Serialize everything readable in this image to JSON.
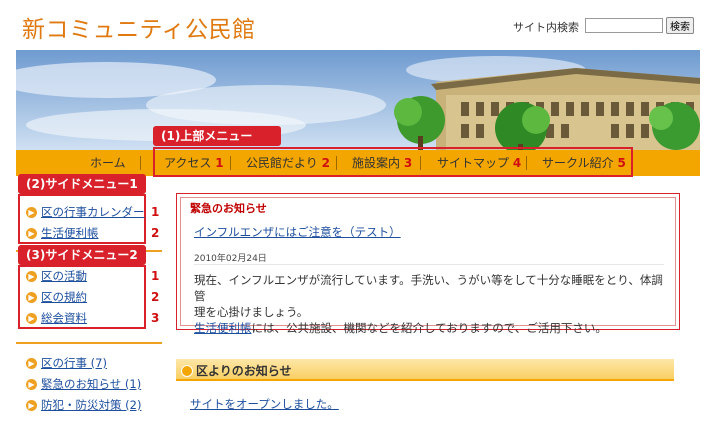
{
  "header": {
    "site_title": "新コミュニティ公民館",
    "search_label": "サイト内検索",
    "search_value": "",
    "search_button": "検索"
  },
  "top_menu_label": "(1)上部メニュー",
  "nav": {
    "home": "ホーム",
    "items": [
      {
        "label": "アクセス",
        "num": "1"
      },
      {
        "label": "公民館だより",
        "num": "2"
      },
      {
        "label": "施設案内",
        "num": "3"
      },
      {
        "label": "サイトマップ",
        "num": "4"
      },
      {
        "label": "サークル紹介",
        "num": "5"
      }
    ]
  },
  "side_menu1": {
    "label": "(2)サイドメニュー1",
    "items": [
      {
        "label": "区の行事カレンダー",
        "num": "1"
      },
      {
        "label": "生活便利帳",
        "num": "2"
      }
    ]
  },
  "side_menu2": {
    "label": "(3)サイドメニュー2",
    "items": [
      {
        "label": "区の活動",
        "num": "1"
      },
      {
        "label": "区の規約",
        "num": "2"
      },
      {
        "label": "総会資料",
        "num": "3"
      }
    ]
  },
  "side_menu3": {
    "items": [
      {
        "label": "区の行事 (7)"
      },
      {
        "label": "緊急のお知らせ (1)"
      },
      {
        "label": "防犯・防災対策 (2)"
      }
    ]
  },
  "emergency": {
    "title": "緊急のお知らせ",
    "link": "インフルエンザにはご注意を（テスト）",
    "date": "2010年02月24日",
    "body_line1": "現在、インフルエンザが流行しています。手洗い、うがい等をして十分な睡眠をとり、体調管",
    "body_line2": "理を心掛けましょう。",
    "body_link": "生活便利帳",
    "body_line3": "には、公共施設、機関などを紹介しておりますので、ご活用下さい。"
  },
  "section": {
    "title": "区よりのお知らせ",
    "link": "サイトをオープンしました。"
  },
  "colors": {
    "accent_orange": "#f3a500",
    "annotation_red": "#d8212a",
    "title_orange": "#e07a10",
    "link_blue": "#1d4f9e"
  }
}
